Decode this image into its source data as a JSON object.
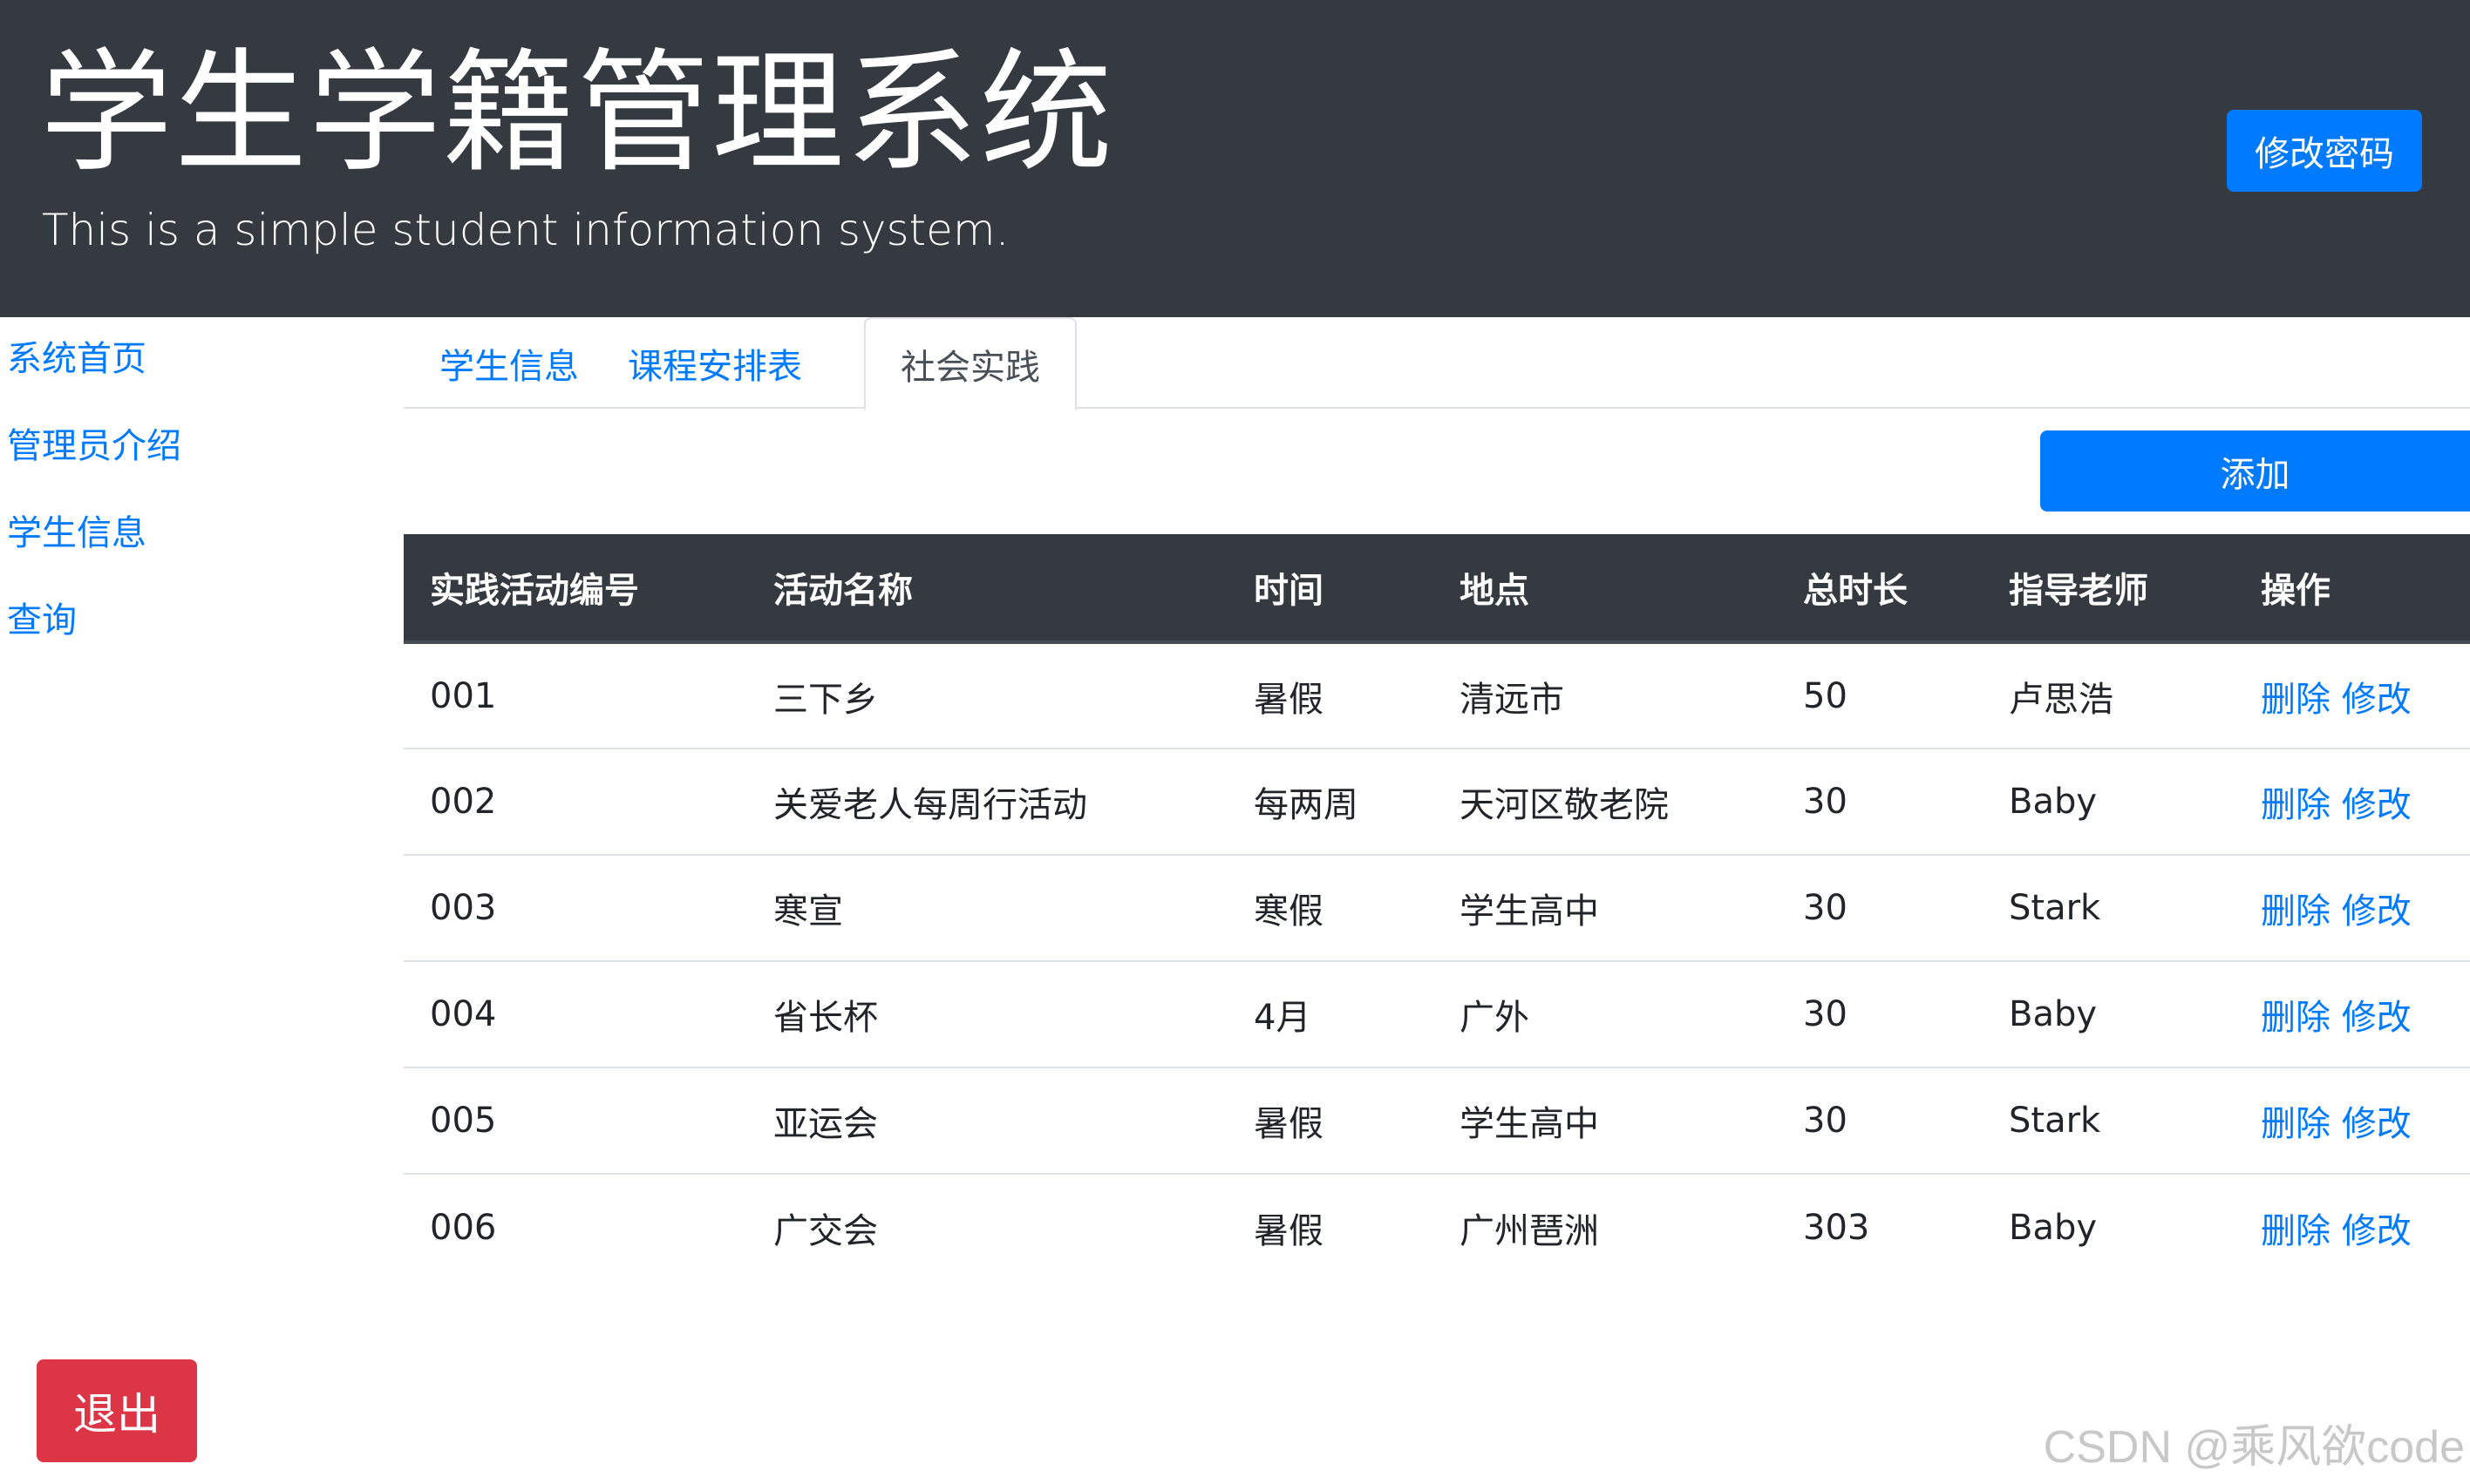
{
  "header": {
    "title": "学生学籍管理系统",
    "subtitle": "This is a simple student information system.",
    "change_password_label": "修改密码"
  },
  "sidebar": {
    "items": [
      {
        "label": "系统首页"
      },
      {
        "label": "管理员介绍"
      },
      {
        "label": "学生信息"
      },
      {
        "label": "查询"
      }
    ]
  },
  "tabs": [
    {
      "label": "学生信息",
      "active": false
    },
    {
      "label": "课程安排表",
      "active": false
    },
    {
      "label": "社会实践",
      "active": true
    }
  ],
  "toolbar": {
    "add_label": "添加"
  },
  "table": {
    "columns": [
      "实践活动编号",
      "活动名称",
      "时间",
      "地点",
      "总时长",
      "指导老师",
      "操作"
    ],
    "rows": [
      {
        "id": "001",
        "name": "三下乡",
        "time": "暑假",
        "place": "清远市",
        "duration": "50",
        "teacher": "卢思浩"
      },
      {
        "id": "002",
        "name": "关爱老人每周行活动",
        "time": "每两周",
        "place": "天河区敬老院",
        "duration": "30",
        "teacher": "Baby"
      },
      {
        "id": "003",
        "name": "寒宣",
        "time": "寒假",
        "place": "学生高中",
        "duration": "30",
        "teacher": "Stark"
      },
      {
        "id": "004",
        "name": "省长杯",
        "time": "4月",
        "place": "广外",
        "duration": "30",
        "teacher": "Baby"
      },
      {
        "id": "005",
        "name": "亚运会",
        "time": "暑假",
        "place": "学生高中",
        "duration": "30",
        "teacher": "Stark"
      },
      {
        "id": "006",
        "name": "广交会",
        "time": "暑假",
        "place": "广州琶洲",
        "duration": "303",
        "teacher": "Baby"
      }
    ],
    "delete_label": "删除",
    "edit_label": "修改"
  },
  "footer": {
    "logout_label": "退出",
    "watermark": "CSDN @乘风欲code"
  },
  "colors": {
    "header_bg": "#343a40",
    "primary": "#007bff",
    "danger": "#dc3545"
  }
}
